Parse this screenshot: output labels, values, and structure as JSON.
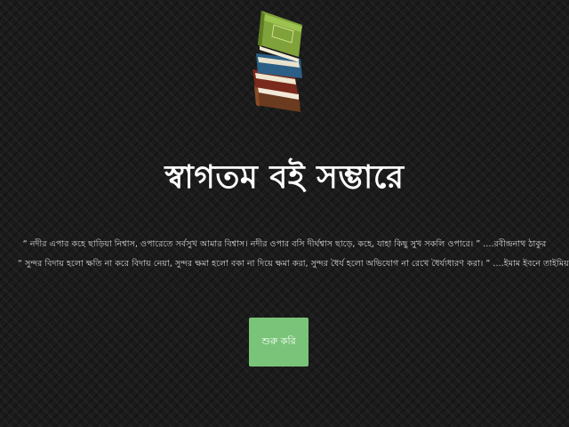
{
  "header": {
    "logo_icon": "book-stack-icon"
  },
  "hero": {
    "title": "স্বাগতম বই সম্ভারে"
  },
  "quotes": [
    "“ নদীর এপার কহে ছাড়িয়া নিশ্বাস, ওপারেতে সর্বসুখ আমার বিশ্বাস। নদীর ওপার বসি দীর্ঘশ্বাস ছাড়ে, কহে, যাহা কিছু সুখ সকলি ওপারে। ” ....রবীন্দ্রনাথ ঠাকুর",
    "“ সুন্দর বিদায় হলো ক্ষতি না করে বিদায় নেয়া, সুন্দর ক্ষমা হলো বকা না দিয়ে ক্ষমা করা, সুন্দর ধৈর্য হলো অভিযোগ না রেখে ধৈর্য্যধারণ করা। ” ....ইমাম ইবনে তাইমিয়া"
  ],
  "actions": {
    "start_label": "শুরু করি"
  },
  "colors": {
    "background": "#1b1b1b",
    "button": "#79c479"
  }
}
